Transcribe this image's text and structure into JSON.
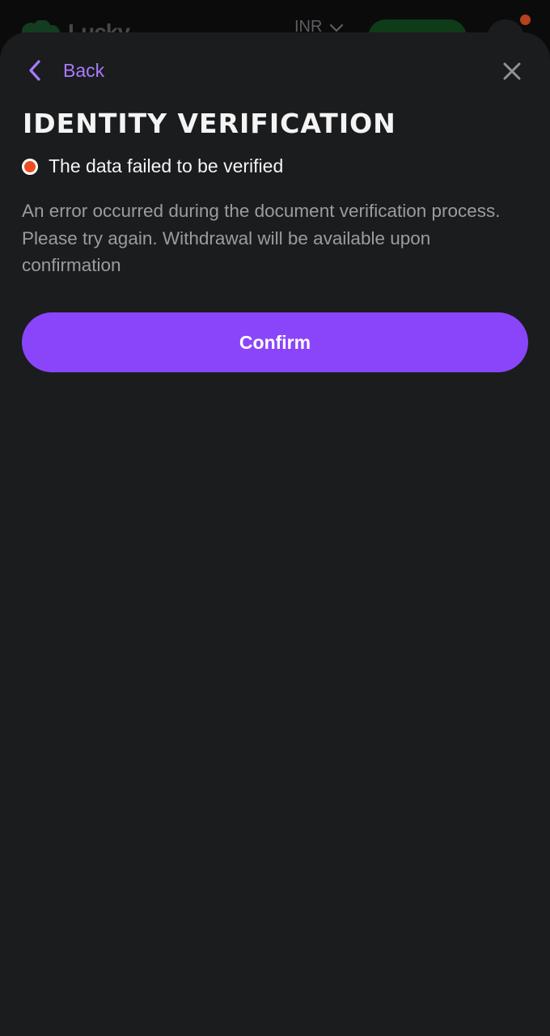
{
  "header": {
    "logo_text": "Lucky",
    "currency": "INR"
  },
  "modal": {
    "back_label": "Back",
    "title": "IDENTITY VERIFICATION",
    "status_text": "The data failed to be verified",
    "description": "An error occurred during the document verification process. Please try again. Withdrawal will be available upon confirmation",
    "confirm_label": "Confirm"
  },
  "colors": {
    "accent": "#8a45fb",
    "back_link": "#a77bff",
    "status_error": "#ee4d1f",
    "modal_bg": "#1b1c1e"
  },
  "icons": {
    "back": "chevron-left-icon",
    "close": "close-icon",
    "status": "status-dot-icon",
    "currency_toggle": "chevron-down-icon"
  }
}
